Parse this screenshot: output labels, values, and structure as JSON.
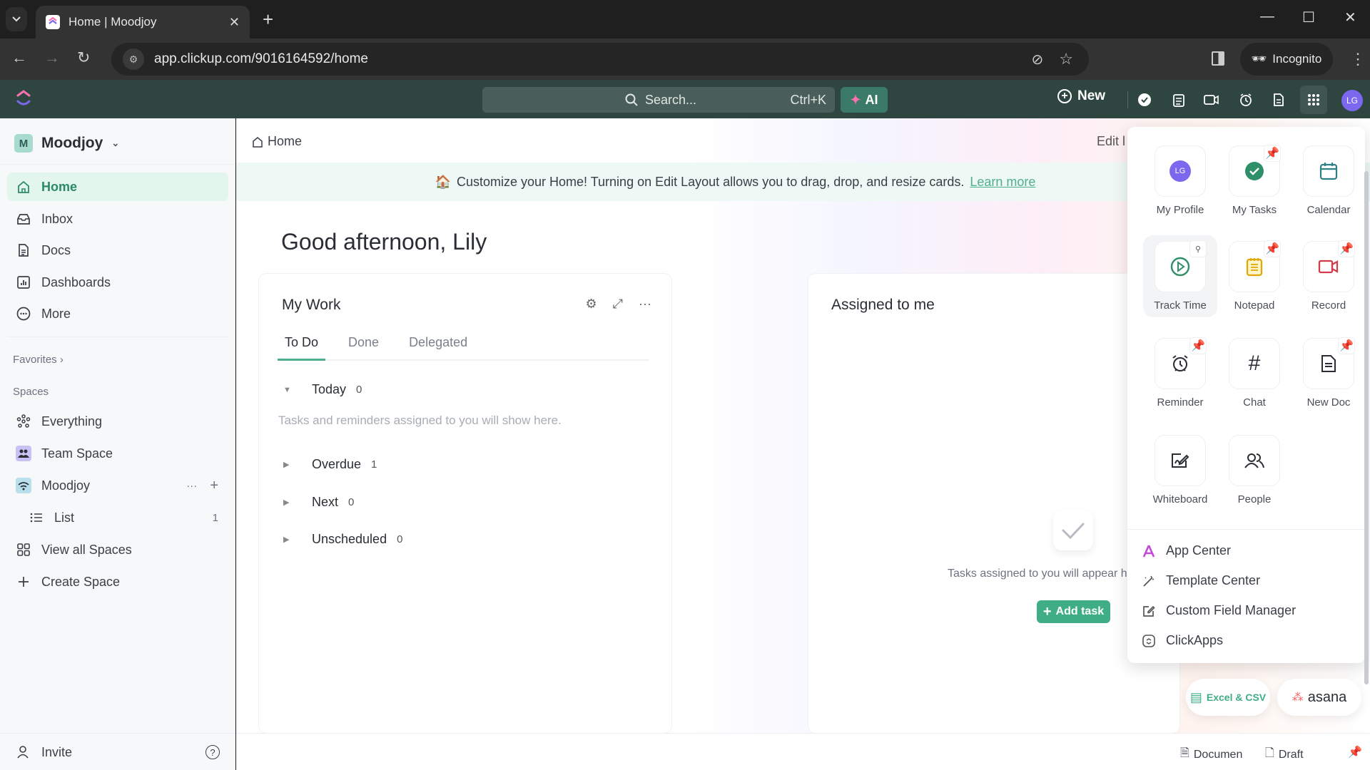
{
  "browser": {
    "tab_title": "Home | Moodjoy",
    "url": "app.clickup.com/9016164592/home",
    "incognito_label": "Incognito"
  },
  "header": {
    "search_placeholder": "Search...",
    "search_shortcut": "Ctrl+K",
    "ai_label": "AI",
    "new_label": "New",
    "avatar_initials": "LG"
  },
  "sidebar": {
    "workspace_initial": "M",
    "workspace_name": "Moodjoy",
    "nav": [
      {
        "label": "Home",
        "icon": "home-icon",
        "active": true
      },
      {
        "label": "Inbox",
        "icon": "inbox-icon"
      },
      {
        "label": "Docs",
        "icon": "docs-icon"
      },
      {
        "label": "Dashboards",
        "icon": "dashboards-icon"
      },
      {
        "label": "More",
        "icon": "more-icon"
      }
    ],
    "favorites_label": "Favorites",
    "spaces_label": "Spaces",
    "spaces": [
      {
        "label": "Everything",
        "icon": "everything-icon"
      },
      {
        "label": "Team Space",
        "icon": "team-space-icon"
      },
      {
        "label": "Moodjoy",
        "icon": "moodjoy-space-icon"
      },
      {
        "label": "List",
        "icon": "list-icon",
        "count": "1"
      },
      {
        "label": "View all Spaces",
        "icon": "grid-icon"
      },
      {
        "label": "Create Space",
        "icon": "plus-icon"
      }
    ],
    "invite_label": "Invite"
  },
  "main": {
    "breadcrumb": "Home",
    "edit_label": "Edit l",
    "banner_text": "Customize your Home! Turning on Edit Layout allows you to drag, drop, and resize cards.",
    "banner_link": "Learn more",
    "greeting": "Good afternoon, Lily",
    "my_work": {
      "title": "My Work",
      "tabs": [
        "To Do",
        "Done",
        "Delegated"
      ],
      "groups": [
        {
          "label": "Today",
          "count": "0",
          "expanded": true
        },
        {
          "label": "Overdue",
          "count": "1"
        },
        {
          "label": "Next",
          "count": "0"
        },
        {
          "label": "Unscheduled",
          "count": "0"
        }
      ],
      "empty_message": "Tasks and reminders assigned to you will show here."
    },
    "assigned": {
      "title": "Assigned to me",
      "empty_message": "Tasks assigned to you will appear he",
      "add_task_label": "Add task"
    }
  },
  "apps_menu": {
    "tiles": [
      {
        "label": "My Profile",
        "icon": "profile-avatar-icon",
        "pinned": false
      },
      {
        "label": "My Tasks",
        "icon": "check-circle-icon",
        "pinned": true
      },
      {
        "label": "Calendar",
        "icon": "calendar-icon",
        "pinned": false
      },
      {
        "label": "Track Time",
        "icon": "play-circle-icon",
        "pinned": false
      },
      {
        "label": "Notepad",
        "icon": "notepad-icon",
        "pinned": true
      },
      {
        "label": "Record",
        "icon": "video-icon",
        "pinned": true
      },
      {
        "label": "Reminder",
        "icon": "alarm-icon",
        "pinned": true
      },
      {
        "label": "Chat",
        "icon": "hash-icon",
        "pinned": false
      },
      {
        "label": "New Doc",
        "icon": "doc-icon",
        "pinned": true
      },
      {
        "label": "Whiteboard",
        "icon": "whiteboard-icon",
        "pinned": false
      },
      {
        "label": "People",
        "icon": "people-icon",
        "pinned": false
      }
    ],
    "links": [
      {
        "label": "App Center",
        "icon": "app-center-icon"
      },
      {
        "label": "Template Center",
        "icon": "magic-wand-icon"
      },
      {
        "label": "Custom Field Manager",
        "icon": "edit-box-icon"
      },
      {
        "label": "ClickApps",
        "icon": "clickapps-icon"
      }
    ]
  },
  "import_buttons": {
    "excel": "Excel & CSV",
    "asana": "asana"
  },
  "bottom_bar": {
    "document": "Documen",
    "draft": "Draft"
  },
  "colors": {
    "accent": "#4fae8c",
    "header_bg": "#2f4540",
    "avatar": "#7b68ee"
  }
}
